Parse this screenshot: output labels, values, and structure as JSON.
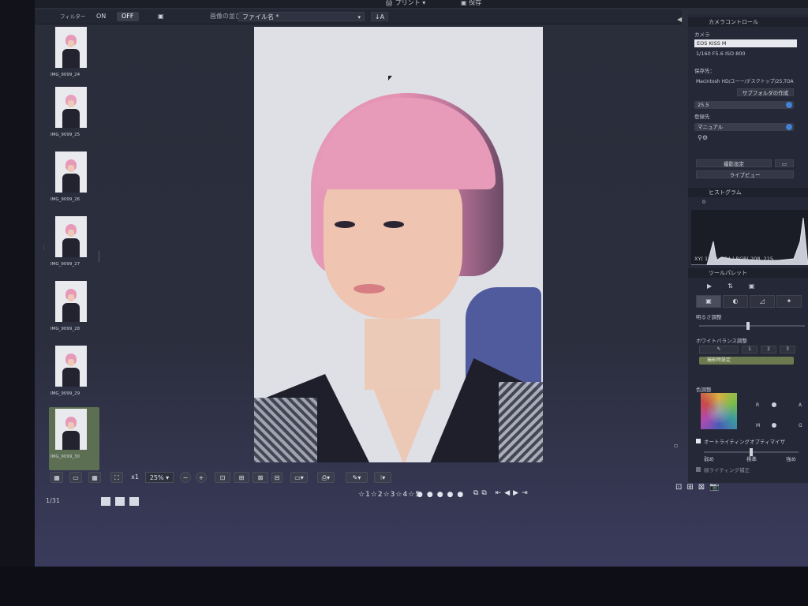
{
  "topbar": {
    "print_label": "プリント",
    "save_label": "保存"
  },
  "filterbar": {
    "filter_label": "フィルター",
    "on_label": "ON",
    "off_label": "OFF",
    "sort_label": "画像の並び順：",
    "sort_value": "ファイル名 *",
    "sort_order_label": "↓A"
  },
  "thumbnails": [
    {
      "caption": "IMG_9099_24",
      "active": false
    },
    {
      "caption": "IMG_9099_25",
      "active": false
    },
    {
      "caption": "IMG_9099_26",
      "active": false
    },
    {
      "caption": "IMG_9099_27",
      "active": false
    },
    {
      "caption": "IMG_9099_28",
      "active": false
    },
    {
      "caption": "IMG_9099_29",
      "active": false
    },
    {
      "caption": "IMG_9099_30",
      "active": true
    }
  ],
  "viewer_toolbar": {
    "zoom_1x_label": "x1",
    "zoom_value": "25%",
    "image_count": "1/31",
    "rating_marks": "☆1☆2☆3☆4☆5"
  },
  "camera_control": {
    "title": "カメラコントロール",
    "camera_label": "カメラ",
    "camera_name": "EOS KISS M",
    "exposure": "1/160  F5.6  ISO 800",
    "save_dest_label": "保存先：",
    "save_dest_path": "Macintosh HD/ユーー/デスクトップ/25,TOA",
    "subfolder_button": "サブフォルダの作成",
    "folder_value": "25.5",
    "register_label": "登録先",
    "register_value": "マニュアル",
    "shooting_settings_button": "撮影設定",
    "live_view_button": "ライブビュー"
  },
  "histogram": {
    "title": "ヒストグラム",
    "zero_label": "0",
    "readout": "XY( 1850,  684 | RGB( 208,  215"
  },
  "tool_palette": {
    "title": "ツールパレット",
    "brightness_label": "明るさ調整",
    "wb_label": "ホワイトバランス調整",
    "wb_preset": "撮影時設定",
    "wb_buttons": [
      "1",
      "2",
      "3"
    ],
    "color_adjust_label": "色調整",
    "cw_labels": {
      "r": "R",
      "a": "A",
      "m": "M",
      "g": "G"
    },
    "auto_lighting_label": "オートライティングオプティマイザ",
    "auto_low": "弱め",
    "auto_std": "標準",
    "auto_high": "強め",
    "face_lighting_label": "顔ライティング補正"
  },
  "colors": {
    "accent": "#3f83d9",
    "active_thumb": "#5c6f52",
    "wb_green": "#6b7a4f"
  }
}
